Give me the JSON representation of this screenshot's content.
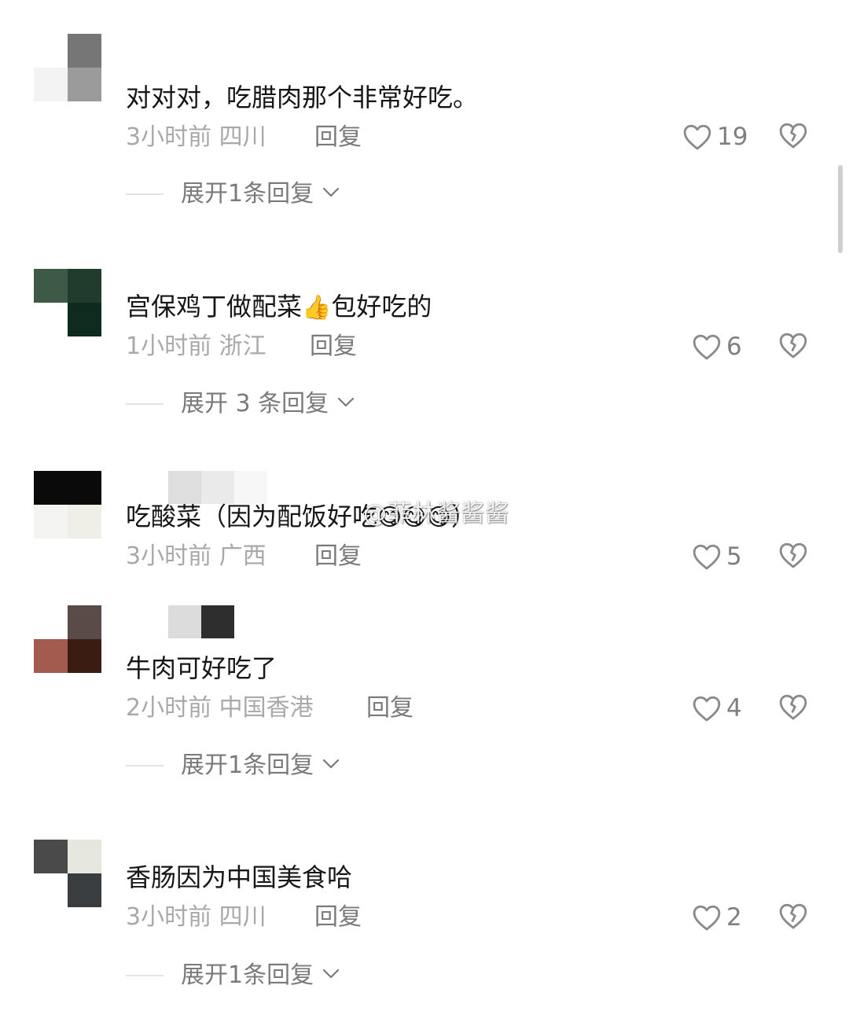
{
  "colors": {
    "text": "#161616",
    "meta": "#a9a9a9",
    "action": "#7a7a7a",
    "divider": "#e3e3e3"
  },
  "comments": [
    {
      "text": "对对对，吃腊肉那个非常好吃。",
      "time": "3小时前",
      "location": "四川",
      "reply_label": "回复",
      "likes": "19",
      "expand_label": "展开1条回复",
      "avatar_colors": [
        "#7a7a7a",
        "#ffffff",
        "#f2f2f2",
        "#9a9a9a"
      ]
    },
    {
      "text": "宫保鸡丁做配菜",
      "emoji": "👍",
      "text_after": "包好吃的",
      "time": "1小时前",
      "location": "浙江",
      "reply_label": "回复",
      "likes": "6",
      "expand_label": "展开 3 条回复",
      "avatar_colors": [
        "#3c5a46",
        "#203a2c",
        "#ffffff",
        "#0f2a1e"
      ]
    },
    {
      "text": "吃酸菜（因为配饭好吃",
      "emoji": "😋😋😋",
      "text_after": "）",
      "time": "3小时前",
      "location": "广西",
      "reply_label": "回复",
      "likes": "5",
      "avatar_colors": [
        "#0a0a0a",
        "#0a0a0a",
        "#f4f4f2",
        "#efefe9"
      ]
    },
    {
      "text": "牛肉可好吃了",
      "time": "2小时前",
      "location": "中国香港",
      "reply_label": "回复",
      "likes": "4",
      "expand_label": "展开1条回复",
      "avatar_colors": [
        "#ffffff",
        "#5a4a48",
        "#a35a4e",
        "#3a1c12"
      ]
    },
    {
      "text": "香肠因为中国美食哈",
      "time": "3小时前",
      "location": "四川",
      "reply_label": "回复",
      "likes": "2",
      "expand_label": "展开1条回复",
      "avatar_colors": [
        "#4a4a4a",
        "#e6e8e0",
        "#ffffff",
        "#3a3d40"
      ]
    }
  ],
  "watermark": "@菲林酱酱酱"
}
